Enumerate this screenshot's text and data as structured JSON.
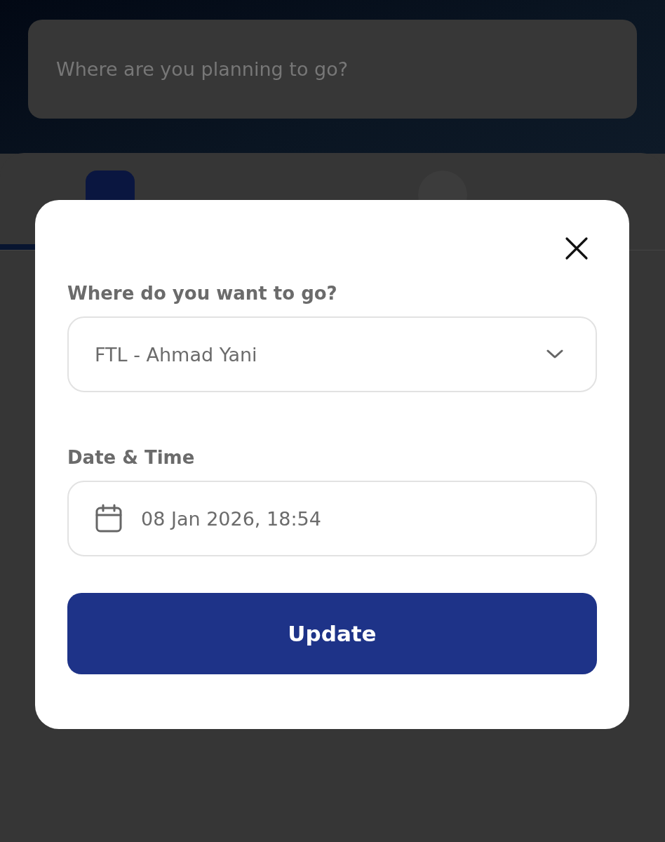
{
  "search": {
    "placeholder": "Where are you planning to go?"
  },
  "tabs": [
    {
      "kind": "activities",
      "selected": true
    },
    {
      "kind": "friends",
      "selected": false
    }
  ],
  "dialog": {
    "destination": {
      "label": "Where do you want to go?",
      "value": "FTL - Ahmad Yani"
    },
    "datetime": {
      "label": "Date & Time",
      "value": "08 Jan 2026, 18:54"
    },
    "button": "Update"
  }
}
